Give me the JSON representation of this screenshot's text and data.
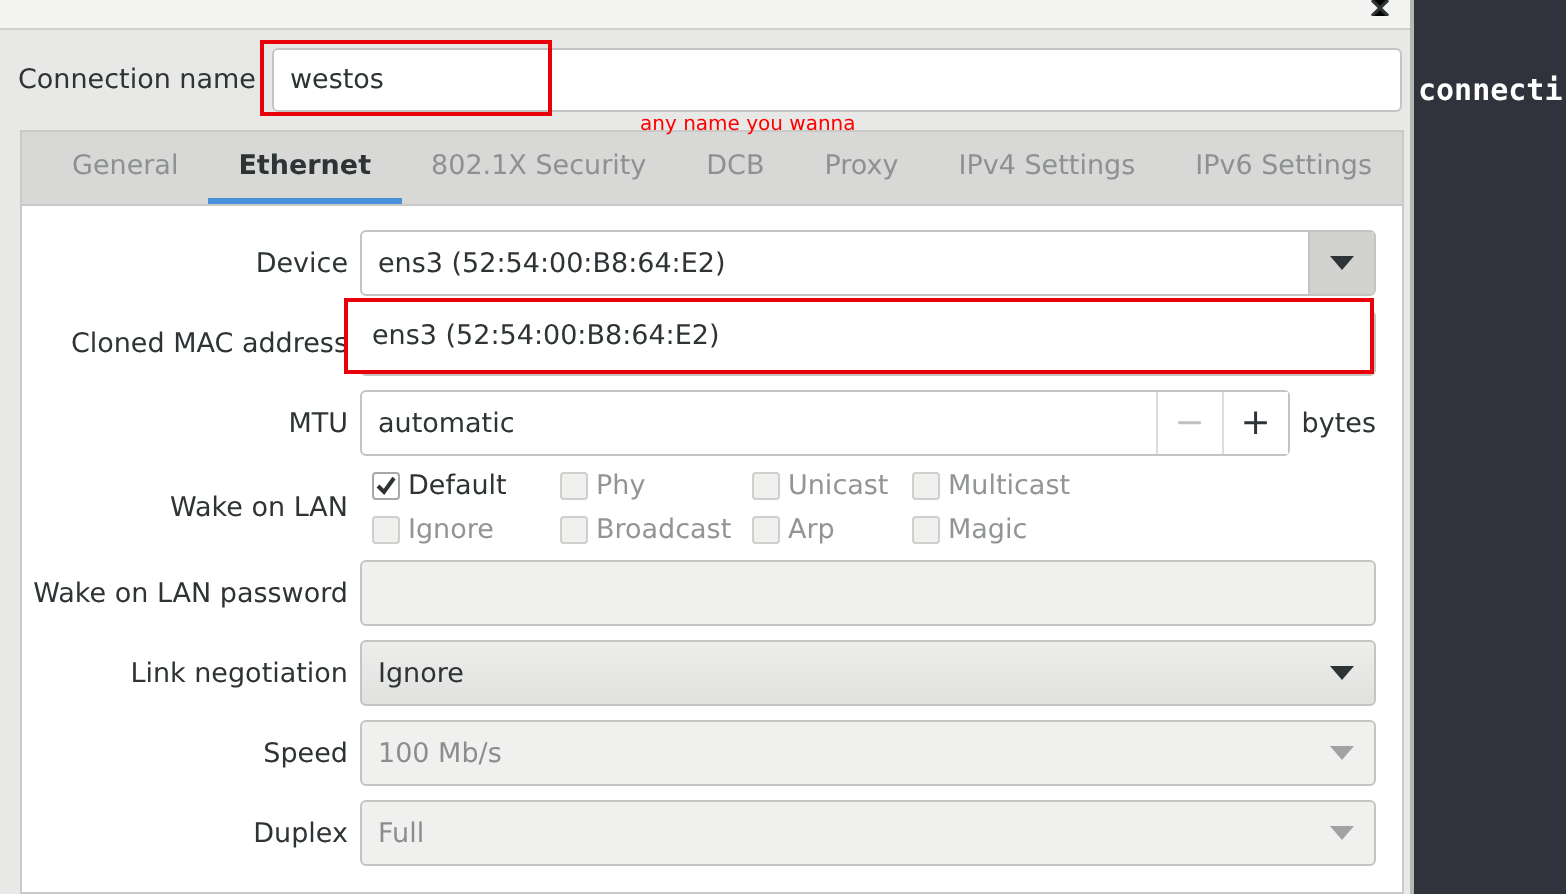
{
  "terminal": {
    "text": "connecti"
  },
  "connection_name": {
    "label": "Connection name",
    "value": "westos"
  },
  "annotation": {
    "note": "any name you wanna"
  },
  "tabs": [
    {
      "label": "General",
      "selected": false
    },
    {
      "label": "Ethernet",
      "selected": true
    },
    {
      "label": "802.1X Security",
      "selected": false
    },
    {
      "label": "DCB",
      "selected": false
    },
    {
      "label": "Proxy",
      "selected": false
    },
    {
      "label": "IPv4 Settings",
      "selected": false
    },
    {
      "label": "IPv6 Settings",
      "selected": false
    }
  ],
  "device": {
    "label": "Device",
    "value": "ens3 (52:54:00:B8:64:E2)",
    "expanded": true,
    "menu_items": [
      "ens3 (52:54:00:B8:64:E2)"
    ]
  },
  "cloned_mac": {
    "label": "Cloned MAC address"
  },
  "mtu": {
    "label": "MTU",
    "value": "automatic",
    "minus": "−",
    "plus": "+",
    "unit": "bytes"
  },
  "wake_on_lan": {
    "label": "Wake on LAN",
    "options": [
      {
        "label": "Default",
        "checked": true,
        "disabled": false
      },
      {
        "label": "Phy",
        "checked": false,
        "disabled": true
      },
      {
        "label": "Unicast",
        "checked": false,
        "disabled": true
      },
      {
        "label": "Multicast",
        "checked": false,
        "disabled": true
      },
      {
        "label": "Ignore",
        "checked": false,
        "disabled": true
      },
      {
        "label": "Broadcast",
        "checked": false,
        "disabled": true
      },
      {
        "label": "Arp",
        "checked": false,
        "disabled": true
      },
      {
        "label": "Magic",
        "checked": false,
        "disabled": true
      }
    ]
  },
  "wol_password": {
    "label": "Wake on LAN password"
  },
  "selects": [
    {
      "label": "Link negotiation",
      "value": "Ignore",
      "disabled": false
    },
    {
      "label": "Speed",
      "value": "100 Mb/s",
      "disabled": true
    },
    {
      "label": "Duplex",
      "value": "Full",
      "disabled": true
    }
  ]
}
